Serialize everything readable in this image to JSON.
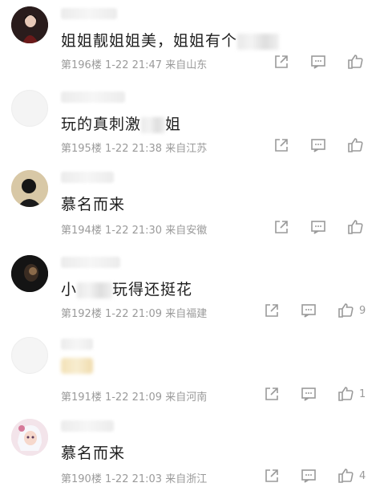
{
  "comments": [
    {
      "text": "姐姐靓姐姐美，姐姐有个",
      "floor": "第196楼",
      "time": "1-22 21:47",
      "location": "来自山东",
      "likes": ""
    },
    {
      "text_a": "玩的真刺激",
      "text_b": "姐",
      "floor": "第195楼",
      "time": "1-22 21:38",
      "location": "来自江苏",
      "likes": ""
    },
    {
      "text": "慕名而来",
      "floor": "第194楼",
      "time": "1-22 21:30",
      "location": "来自安徽",
      "likes": ""
    },
    {
      "text_a": "小",
      "text_b": "玩得还挺花",
      "floor": "第192楼",
      "time": "1-22 21:09",
      "location": "来自福建",
      "likes": "9"
    },
    {
      "text": "",
      "floor": "第191楼",
      "time": "1-22 21:09",
      "location": "来自河南",
      "likes": "1"
    },
    {
      "text": "慕名而来",
      "floor": "第190楼",
      "time": "1-22 21:03",
      "location": "来自浙江",
      "likes": "4"
    }
  ],
  "colors": {
    "icon": "#9a9a9a",
    "meta_text": "#9a9a9a",
    "comment_text": "#1e1e1e"
  },
  "icons": [
    "share-icon",
    "reply-icon",
    "like-icon"
  ]
}
